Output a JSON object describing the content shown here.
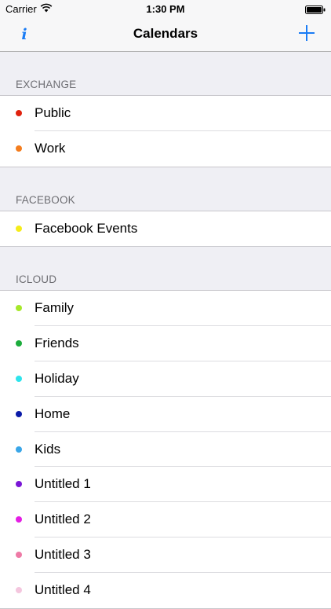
{
  "status_bar": {
    "carrier": "Carrier",
    "time": "1:30 PM"
  },
  "nav": {
    "title": "Calendars",
    "info_label": "i",
    "info_icon": "info-icon",
    "add_icon": "plus-icon"
  },
  "accent_color": "#1a7cf5",
  "sections": [
    {
      "title": "EXCHANGE",
      "items": [
        {
          "label": "Public",
          "color": "#e0220e"
        },
        {
          "label": "Work",
          "color": "#f47d1e"
        }
      ]
    },
    {
      "title": "FACEBOOK",
      "items": [
        {
          "label": "Facebook Events",
          "color": "#f5ec1a"
        }
      ]
    },
    {
      "title": "ICLOUD",
      "items": [
        {
          "label": "Family",
          "color": "#a6e82a"
        },
        {
          "label": "Friends",
          "color": "#1cac3c"
        },
        {
          "label": "Holiday",
          "color": "#2ee4ec"
        },
        {
          "label": "Home",
          "color": "#0a1aa8"
        },
        {
          "label": "Kids",
          "color": "#3aa6e8"
        },
        {
          "label": "Untitled 1",
          "color": "#7a16d6"
        },
        {
          "label": "Untitled 2",
          "color": "#e41ee4"
        },
        {
          "label": "Untitled 3",
          "color": "#ee7aa6"
        },
        {
          "label": "Untitled 4",
          "color": "#f4c6de"
        }
      ]
    }
  ]
}
